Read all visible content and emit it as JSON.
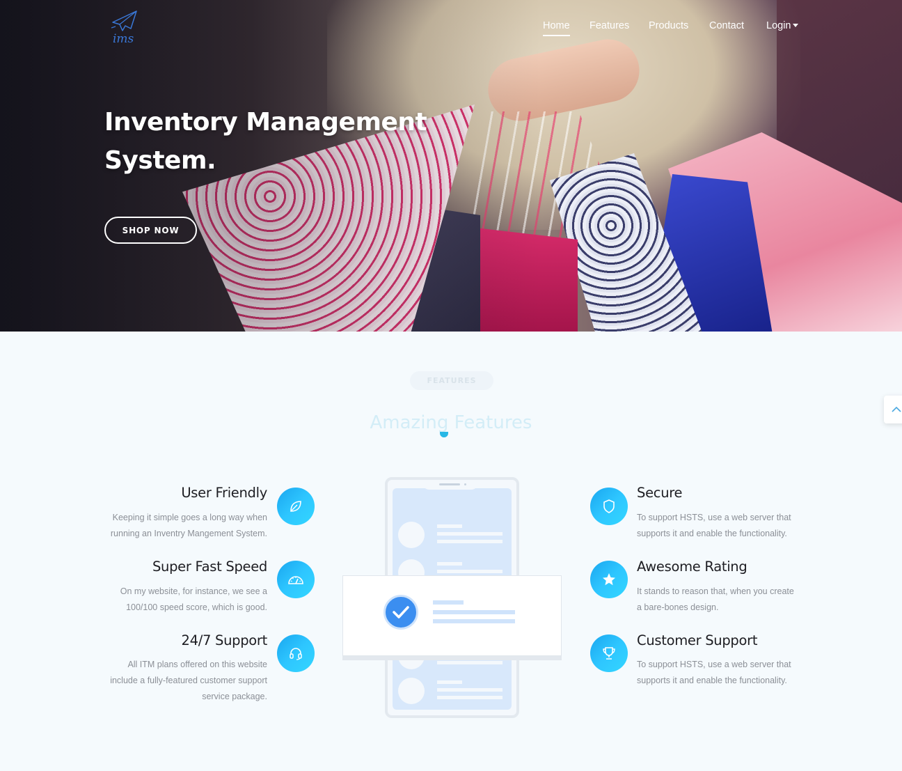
{
  "brand": {
    "logo_text": "ims",
    "logo_icon": "paper-plane-icon"
  },
  "nav": {
    "items": [
      {
        "label": "Home",
        "active": true
      },
      {
        "label": "Features"
      },
      {
        "label": "Products"
      },
      {
        "label": "Contact"
      },
      {
        "label": "Login",
        "dropdown": true
      }
    ]
  },
  "hero": {
    "title_line1": "Inventory Management",
    "title_line2": "System.",
    "cta_label": "SHOP NOW"
  },
  "features": {
    "badge": "FEATURES",
    "title": "Amazing Features",
    "left": [
      {
        "title": "User Friendly",
        "text_lines": [
          "Keeping it simple goes a long way when",
          "running an Inventry Mangement System."
        ],
        "icon": "leaf-icon"
      },
      {
        "title": "Super Fast Speed",
        "text_lines": [
          "On my website, for instance, we see a",
          "100/100 speed score, which is good."
        ],
        "icon": "speedometer-icon"
      },
      {
        "title": "24/7 Support",
        "text_lines": [
          "All ITM plans offered on this website",
          "include a fully-featured customer support",
          "service package."
        ],
        "icon": "headset-icon"
      }
    ],
    "right": [
      {
        "title": "Secure",
        "text_lines": [
          "To support HSTS, use a web server that",
          "supports it and enable the functionality."
        ],
        "icon": "shield-icon"
      },
      {
        "title": "Awesome Rating",
        "text_lines": [
          "It stands to reason that, when you create",
          "a bare-bones design."
        ],
        "icon": "star-icon"
      },
      {
        "title": "Customer Support",
        "text_lines": [
          "To support HSTS, use a web server that",
          "supports it and enable the functionality."
        ],
        "icon": "trophy-icon"
      }
    ]
  },
  "colors": {
    "accent": "#1fb6f5",
    "accent_dark": "#1aa6ef",
    "hero_text": "#ffffff",
    "body_text": "#8b8f96"
  },
  "scroll_top_icon": "chevron-up-icon"
}
